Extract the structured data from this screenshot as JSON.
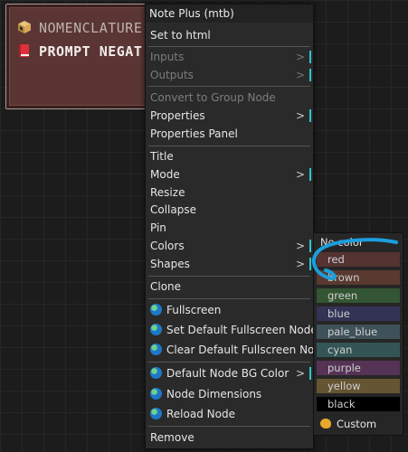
{
  "node": {
    "line1": "NOMENCLATURE",
    "line2": "PROMPT NEGAT",
    "line1_icon": "box-icon",
    "line2_icon": "red-book-icon"
  },
  "menu": {
    "title": "Note Plus (mtb)",
    "items": [
      {
        "label": "Set to html"
      },
      {
        "label": "Inputs",
        "disabled": true,
        "submenu": true
      },
      {
        "label": "Outputs",
        "disabled": true,
        "submenu": true
      },
      {
        "label": "Convert to Group Node",
        "disabled": true
      },
      {
        "label": "Properties",
        "submenu": true
      },
      {
        "label": "Properties Panel"
      },
      {
        "label": "Title"
      },
      {
        "label": "Mode",
        "submenu": true
      },
      {
        "label": "Resize"
      },
      {
        "label": "Collapse"
      },
      {
        "label": "Pin"
      },
      {
        "label": "Colors",
        "submenu": true
      },
      {
        "label": "Shapes",
        "submenu": true
      },
      {
        "label": "Clone"
      },
      {
        "label": "Fullscreen",
        "icon": "globe-icon"
      },
      {
        "label": "Set Default Fullscreen Node",
        "icon": "globe-icon"
      },
      {
        "label": "Clear Default Fullscreen Node",
        "icon": "globe-icon"
      },
      {
        "label": "Default Node BG Color",
        "icon": "globe-icon",
        "submenu": true
      },
      {
        "label": "Node Dimensions",
        "icon": "globe-icon"
      },
      {
        "label": "Reload Node",
        "icon": "globe-icon"
      },
      {
        "label": "Remove"
      }
    ],
    "arrow_glyph": ">"
  },
  "colors_submenu": {
    "no_color_label": "No color",
    "custom_label": "Custom",
    "options": [
      {
        "label": "red",
        "color": "#553333"
      },
      {
        "label": "brown",
        "color": "#593930"
      },
      {
        "label": "green",
        "color": "#335533"
      },
      {
        "label": "blue",
        "color": "#333355"
      },
      {
        "label": "pale_blue",
        "color": "#3f5159"
      },
      {
        "label": "cyan",
        "color": "#335555"
      },
      {
        "label": "purple",
        "color": "#553355"
      },
      {
        "label": "yellow",
        "color": "#665533"
      },
      {
        "label": "black",
        "color": "#000000"
      }
    ]
  },
  "accent_color": "#2fc4d2",
  "annotation_color": "#1a9fdc"
}
